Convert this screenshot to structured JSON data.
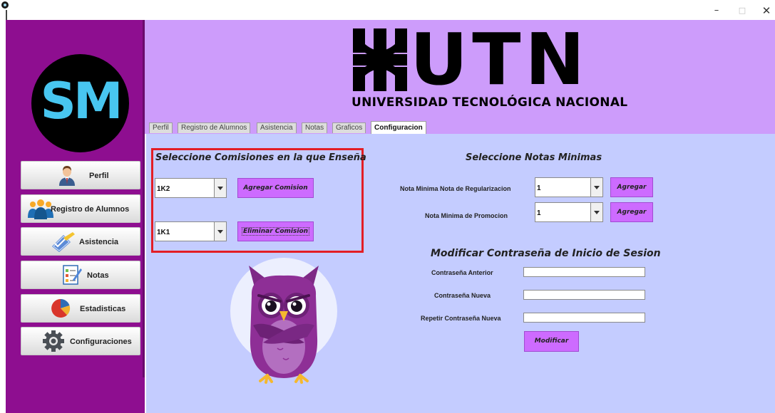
{
  "window": {
    "minimize": "–",
    "maximize": "□",
    "close": "✕"
  },
  "sidebar": {
    "logo_text": "SM",
    "items": [
      {
        "label": "Perfil",
        "icon": "user-icon"
      },
      {
        "label": "Registro de Alumnos",
        "icon": "students-icon"
      },
      {
        "label": "Asistencia",
        "icon": "attendance-icon"
      },
      {
        "label": "Notas",
        "icon": "notes-icon"
      },
      {
        "label": "Estadisticas",
        "icon": "pie-chart-icon"
      },
      {
        "label": "Configuraciones",
        "icon": "gear-icon"
      }
    ]
  },
  "header": {
    "logo_letters": "UTN",
    "university_name": "UNIVERSIDAD TECNOLÓGICA NACIONAL"
  },
  "tabs": [
    {
      "label": "Perfil",
      "active": false
    },
    {
      "label": "Registro de Alumnos",
      "active": false
    },
    {
      "label": "Asistencia",
      "active": false
    },
    {
      "label": "Notas",
      "active": false
    },
    {
      "label": "Graficos",
      "active": false
    },
    {
      "label": "Configuracion",
      "active": true
    }
  ],
  "commissions": {
    "title": "Seleccione Comisiones en la que Enseña",
    "add_combo_value": "1K2",
    "add_button": "Agregar Comision",
    "remove_combo_value": "1K1",
    "remove_button": "Eliminar Comision"
  },
  "min_grades": {
    "title": "Seleccione Notas Minimas",
    "regularization_label": "Nota Minima Nota de Regularizacion",
    "regularization_value": "1",
    "regularization_button": "Agregar",
    "promotion_label": "Nota Minima de Promocion",
    "promotion_value": "1",
    "promotion_button": "Agregar"
  },
  "password": {
    "title": "Modificar Contraseña de Inicio de Sesion",
    "old_label": "Contraseña Anterior",
    "old_value": "",
    "new_label": "Contraseña Nueva",
    "new_value": "",
    "repeat_label": "Repetir Contraseña Nueva",
    "repeat_value": "",
    "submit_button": "Modificar"
  },
  "colors": {
    "sidebar": "#8e0e90",
    "header": "#cd9cfb",
    "content": "#c4ccff",
    "button": "#cd6bff",
    "highlight_border": "#e31e25"
  }
}
